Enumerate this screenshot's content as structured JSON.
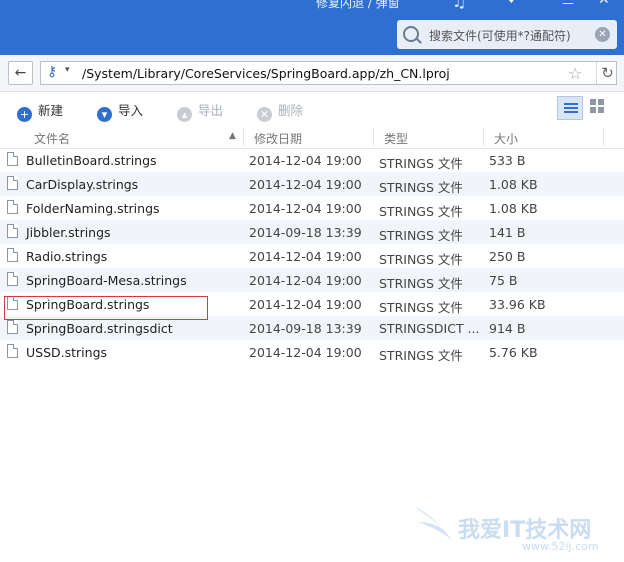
{
  "titlebar": {
    "top_text": "修复闪退 / 弹窗",
    "search_placeholder": "搜索文件(可使用*?通配符)"
  },
  "address": {
    "path": "/System/Library/CoreServices/SpringBoard.app/zh_CN.lproj"
  },
  "toolbar": {
    "new_label": "新建",
    "import_label": "导入",
    "export_label": "导出",
    "delete_label": "删除"
  },
  "columns": {
    "name": "文件名",
    "date": "修改日期",
    "type": "类型",
    "size": "大小"
  },
  "files": [
    {
      "name": "BulletinBoard.strings",
      "date": "2014-12-04 19:00",
      "type": "STRINGS 文件",
      "size": "533 B"
    },
    {
      "name": "CarDisplay.strings",
      "date": "2014-12-04 19:00",
      "type": "STRINGS 文件",
      "size": "1.08 KB"
    },
    {
      "name": "FolderNaming.strings",
      "date": "2014-12-04 19:00",
      "type": "STRINGS 文件",
      "size": "1.08 KB"
    },
    {
      "name": "Jibbler.strings",
      "date": "2014-09-18 13:39",
      "type": "STRINGS 文件",
      "size": "141 B"
    },
    {
      "name": "Radio.strings",
      "date": "2014-12-04 19:00",
      "type": "STRINGS 文件",
      "size": "250 B"
    },
    {
      "name": "SpringBoard-Mesa.strings",
      "date": "2014-12-04 19:00",
      "type": "STRINGS 文件",
      "size": "75 B"
    },
    {
      "name": "SpringBoard.strings",
      "date": "2014-12-04 19:00",
      "type": "STRINGS 文件",
      "size": "33.96 KB"
    },
    {
      "name": "SpringBoard.stringsdict",
      "date": "2014-09-18 13:39",
      "type": "STRINGSDICT ...",
      "size": "914 B"
    },
    {
      "name": "USSD.strings",
      "date": "2014-12-04 19:00",
      "type": "STRINGS 文件",
      "size": "5.76 KB"
    }
  ],
  "watermark": {
    "text": "我爱IT技术网",
    "url": "www.52ij.com"
  },
  "colors": {
    "titlebar": "#2f6fd0",
    "highlight_border": "#d63a3a",
    "row_alt": "#f1f4f9"
  },
  "icons": [
    "music-icon",
    "heart-icon",
    "minimize-icon",
    "close-icon",
    "search-icon",
    "clear-icon",
    "back-arrow-icon",
    "key-icon",
    "star-icon",
    "refresh-icon",
    "plus-icon",
    "import-icon",
    "export-icon",
    "delete-icon",
    "list-view-icon",
    "grid-view-icon",
    "file-icon"
  ]
}
